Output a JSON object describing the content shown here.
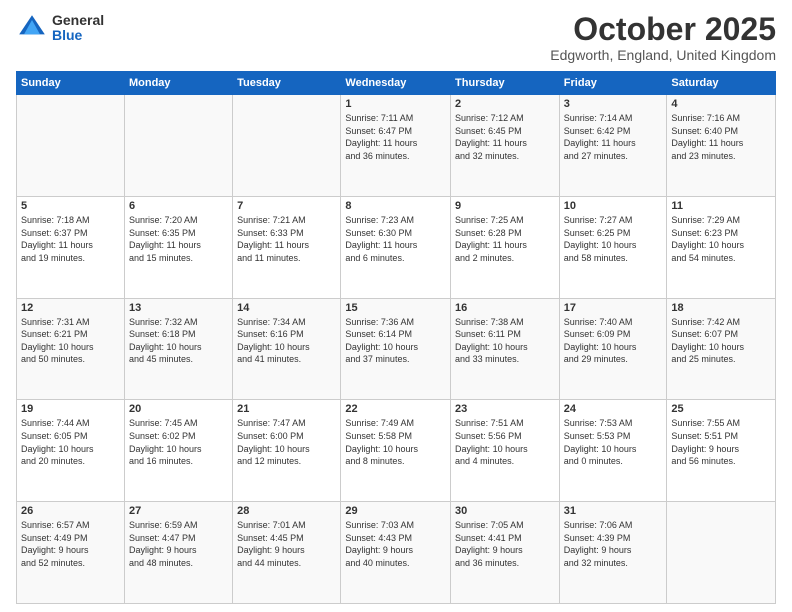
{
  "header": {
    "logo_general": "General",
    "logo_blue": "Blue",
    "month_title": "October 2025",
    "location": "Edgworth, England, United Kingdom"
  },
  "days_of_week": [
    "Sunday",
    "Monday",
    "Tuesday",
    "Wednesday",
    "Thursday",
    "Friday",
    "Saturday"
  ],
  "weeks": [
    [
      {
        "day": "",
        "info": ""
      },
      {
        "day": "",
        "info": ""
      },
      {
        "day": "",
        "info": ""
      },
      {
        "day": "1",
        "info": "Sunrise: 7:11 AM\nSunset: 6:47 PM\nDaylight: 11 hours\nand 36 minutes."
      },
      {
        "day": "2",
        "info": "Sunrise: 7:12 AM\nSunset: 6:45 PM\nDaylight: 11 hours\nand 32 minutes."
      },
      {
        "day": "3",
        "info": "Sunrise: 7:14 AM\nSunset: 6:42 PM\nDaylight: 11 hours\nand 27 minutes."
      },
      {
        "day": "4",
        "info": "Sunrise: 7:16 AM\nSunset: 6:40 PM\nDaylight: 11 hours\nand 23 minutes."
      }
    ],
    [
      {
        "day": "5",
        "info": "Sunrise: 7:18 AM\nSunset: 6:37 PM\nDaylight: 11 hours\nand 19 minutes."
      },
      {
        "day": "6",
        "info": "Sunrise: 7:20 AM\nSunset: 6:35 PM\nDaylight: 11 hours\nand 15 minutes."
      },
      {
        "day": "7",
        "info": "Sunrise: 7:21 AM\nSunset: 6:33 PM\nDaylight: 11 hours\nand 11 minutes."
      },
      {
        "day": "8",
        "info": "Sunrise: 7:23 AM\nSunset: 6:30 PM\nDaylight: 11 hours\nand 6 minutes."
      },
      {
        "day": "9",
        "info": "Sunrise: 7:25 AM\nSunset: 6:28 PM\nDaylight: 11 hours\nand 2 minutes."
      },
      {
        "day": "10",
        "info": "Sunrise: 7:27 AM\nSunset: 6:25 PM\nDaylight: 10 hours\nand 58 minutes."
      },
      {
        "day": "11",
        "info": "Sunrise: 7:29 AM\nSunset: 6:23 PM\nDaylight: 10 hours\nand 54 minutes."
      }
    ],
    [
      {
        "day": "12",
        "info": "Sunrise: 7:31 AM\nSunset: 6:21 PM\nDaylight: 10 hours\nand 50 minutes."
      },
      {
        "day": "13",
        "info": "Sunrise: 7:32 AM\nSunset: 6:18 PM\nDaylight: 10 hours\nand 45 minutes."
      },
      {
        "day": "14",
        "info": "Sunrise: 7:34 AM\nSunset: 6:16 PM\nDaylight: 10 hours\nand 41 minutes."
      },
      {
        "day": "15",
        "info": "Sunrise: 7:36 AM\nSunset: 6:14 PM\nDaylight: 10 hours\nand 37 minutes."
      },
      {
        "day": "16",
        "info": "Sunrise: 7:38 AM\nSunset: 6:11 PM\nDaylight: 10 hours\nand 33 minutes."
      },
      {
        "day": "17",
        "info": "Sunrise: 7:40 AM\nSunset: 6:09 PM\nDaylight: 10 hours\nand 29 minutes."
      },
      {
        "day": "18",
        "info": "Sunrise: 7:42 AM\nSunset: 6:07 PM\nDaylight: 10 hours\nand 25 minutes."
      }
    ],
    [
      {
        "day": "19",
        "info": "Sunrise: 7:44 AM\nSunset: 6:05 PM\nDaylight: 10 hours\nand 20 minutes."
      },
      {
        "day": "20",
        "info": "Sunrise: 7:45 AM\nSunset: 6:02 PM\nDaylight: 10 hours\nand 16 minutes."
      },
      {
        "day": "21",
        "info": "Sunrise: 7:47 AM\nSunset: 6:00 PM\nDaylight: 10 hours\nand 12 minutes."
      },
      {
        "day": "22",
        "info": "Sunrise: 7:49 AM\nSunset: 5:58 PM\nDaylight: 10 hours\nand 8 minutes."
      },
      {
        "day": "23",
        "info": "Sunrise: 7:51 AM\nSunset: 5:56 PM\nDaylight: 10 hours\nand 4 minutes."
      },
      {
        "day": "24",
        "info": "Sunrise: 7:53 AM\nSunset: 5:53 PM\nDaylight: 10 hours\nand 0 minutes."
      },
      {
        "day": "25",
        "info": "Sunrise: 7:55 AM\nSunset: 5:51 PM\nDaylight: 9 hours\nand 56 minutes."
      }
    ],
    [
      {
        "day": "26",
        "info": "Sunrise: 6:57 AM\nSunset: 4:49 PM\nDaylight: 9 hours\nand 52 minutes."
      },
      {
        "day": "27",
        "info": "Sunrise: 6:59 AM\nSunset: 4:47 PM\nDaylight: 9 hours\nand 48 minutes."
      },
      {
        "day": "28",
        "info": "Sunrise: 7:01 AM\nSunset: 4:45 PM\nDaylight: 9 hours\nand 44 minutes."
      },
      {
        "day": "29",
        "info": "Sunrise: 7:03 AM\nSunset: 4:43 PM\nDaylight: 9 hours\nand 40 minutes."
      },
      {
        "day": "30",
        "info": "Sunrise: 7:05 AM\nSunset: 4:41 PM\nDaylight: 9 hours\nand 36 minutes."
      },
      {
        "day": "31",
        "info": "Sunrise: 7:06 AM\nSunset: 4:39 PM\nDaylight: 9 hours\nand 32 minutes."
      },
      {
        "day": "",
        "info": ""
      }
    ]
  ]
}
